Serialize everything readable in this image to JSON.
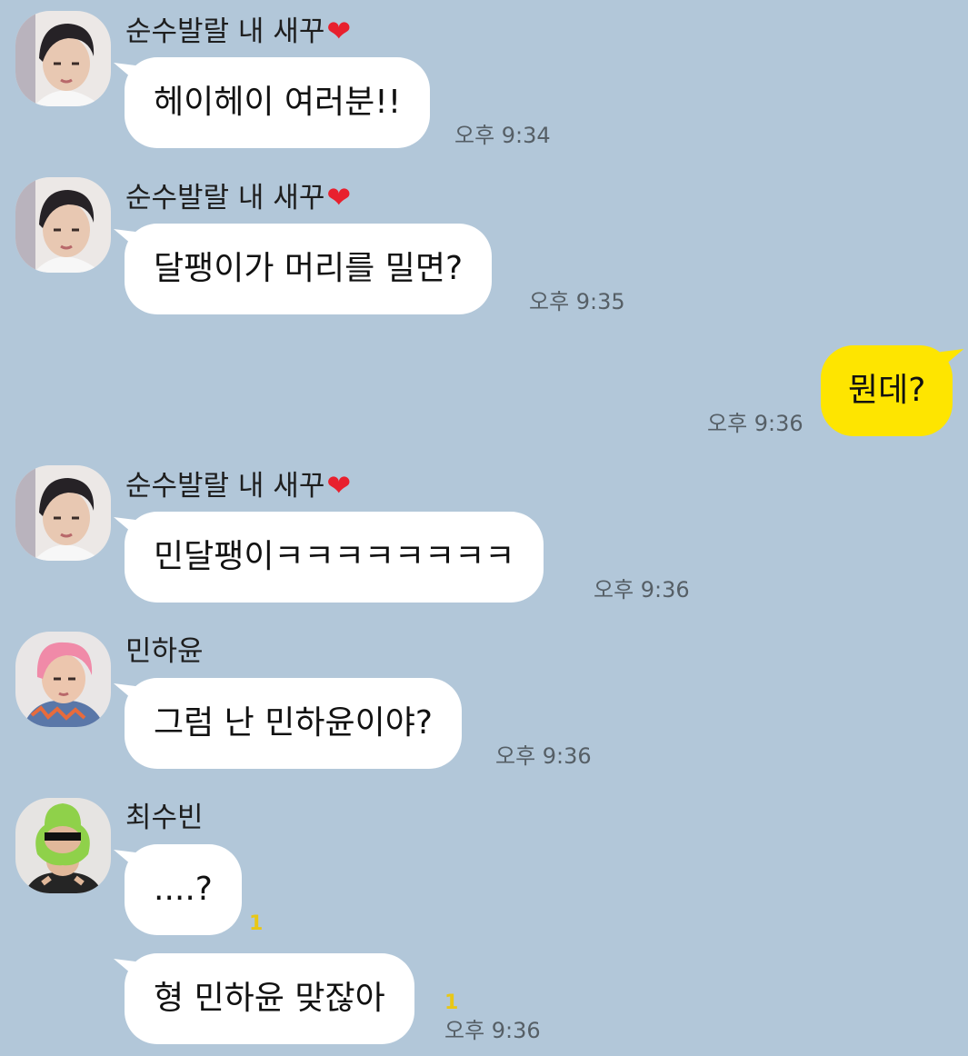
{
  "colors": {
    "background": "#b2c7d9",
    "incoming_bubble": "#ffffff",
    "outgoing_bubble": "#fee500",
    "unread": "#e8c716",
    "heart": "#e8202e"
  },
  "messages": [
    {
      "sender": "순수발랄 내 새꾸",
      "heart": "❤",
      "text": "헤이헤이 여러분!!",
      "time": "오후 9:34"
    },
    {
      "sender": "순수발랄 내 새꾸",
      "heart": "❤",
      "text": "달팽이가 머리를 밀면?",
      "time": "오후 9:35"
    },
    {
      "text": "뭔데?",
      "time": "오후 9:36"
    },
    {
      "sender": "순수발랄 내 새꾸",
      "heart": "❤",
      "text": "민달팽이ㅋㅋㅋㅋㅋㅋㅋㅋ",
      "time": "오후 9:36"
    },
    {
      "sender": "민하윤",
      "text": "그럼 난 민하윤이야?",
      "time": "오후 9:36"
    },
    {
      "sender": "최수빈",
      "text": "....?",
      "unread": "1"
    },
    {
      "text": "형 민하윤 맞잖아",
      "unread": "1",
      "time": "오후 9:36"
    }
  ],
  "avatars": [
    {
      "icon": "profile-photo-dark-hair"
    },
    {
      "icon": "profile-photo-pink-hair"
    },
    {
      "icon": "profile-photo-green-hat"
    }
  ]
}
